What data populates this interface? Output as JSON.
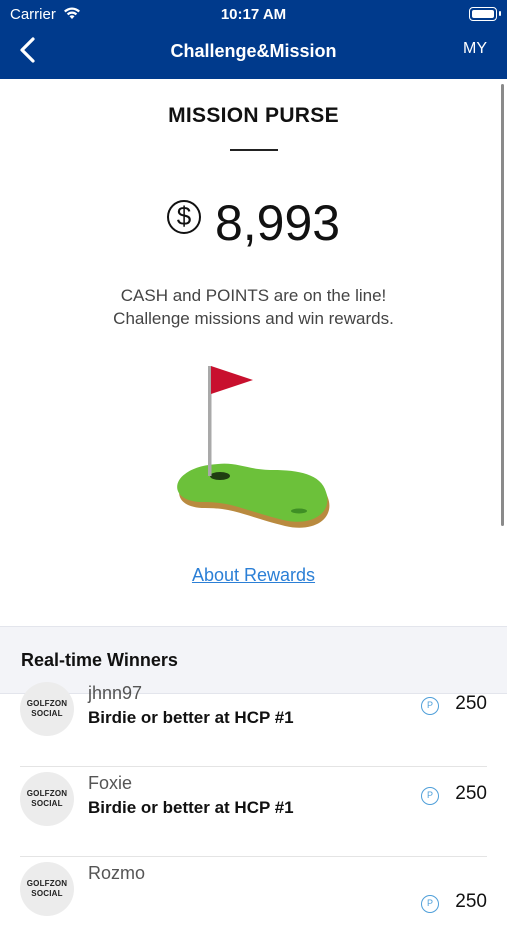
{
  "status_bar": {
    "carrier": "Carrier",
    "time": "10:17 AM"
  },
  "nav": {
    "title": "Challenge&Mission",
    "my_label": "MY"
  },
  "mission_purse": {
    "title": "MISSION PURSE",
    "currency_symbol": "$",
    "amount": "8,993",
    "description_line1": "CASH and POINTS are on the line!",
    "description_line2": "Challenge missions and win rewards.",
    "about_link": "About Rewards"
  },
  "winners": {
    "title": "Real-time Winners",
    "avatar_line1": "GOLFZON",
    "avatar_line2": "SOCIAL",
    "points_icon": "P",
    "items": [
      {
        "user": "jhnn97",
        "mission": "Birdie or better at HCP #1",
        "points": "250"
      },
      {
        "user": "Foxie",
        "mission": "Birdie or better at HCP #1",
        "points": "250"
      },
      {
        "user": "Rozmo",
        "mission": "",
        "points": "250"
      }
    ]
  },
  "colors": {
    "nav_bg": "#003a8c",
    "link": "#2b7fd6",
    "points_icon": "#4f9fd9"
  }
}
